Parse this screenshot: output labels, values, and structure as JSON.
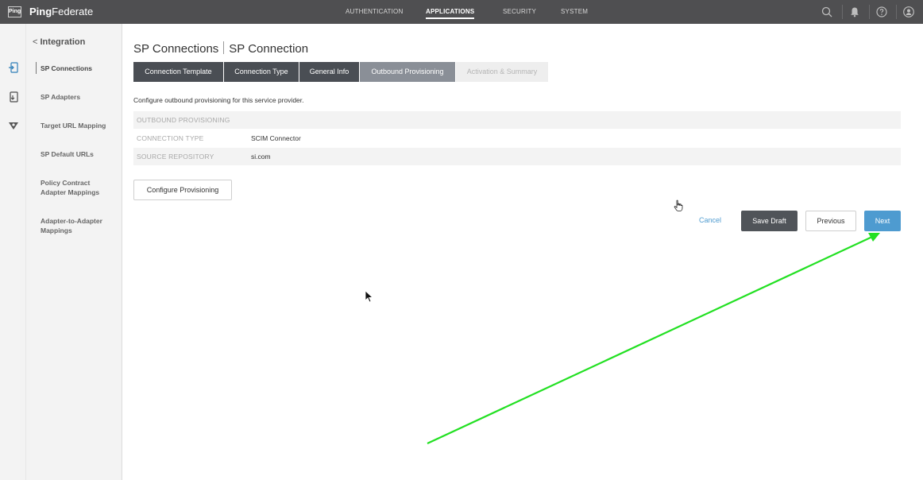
{
  "app": {
    "logo_text": "Ping",
    "brand_bold": "Ping",
    "brand_rest": "Federate"
  },
  "topnav": [
    {
      "label": "AUTHENTICATION",
      "active": false
    },
    {
      "label": "APPLICATIONS",
      "active": true
    },
    {
      "label": "SECURITY",
      "active": false
    },
    {
      "label": "SYSTEM",
      "active": false
    }
  ],
  "top_icons": [
    "search-icon",
    "bell-icon",
    "help-icon",
    "user-icon"
  ],
  "strip_icons": [
    "connection-icon",
    "adapter-icon",
    "mapping-icon"
  ],
  "sidebar": {
    "back_label": "Integration",
    "back_chevron": "<",
    "items": [
      {
        "label": "SP Connections",
        "active": true
      },
      {
        "label": "SP Adapters",
        "active": false
      },
      {
        "label": "Target URL Mapping",
        "active": false
      },
      {
        "label": "SP Default URLs",
        "active": false
      },
      {
        "label": "Policy Contract Adapter Mappings",
        "active": false
      },
      {
        "label": "Adapter-to-Adapter Mappings",
        "active": false
      }
    ]
  },
  "page": {
    "title_main": "SP Connections",
    "title_sub": "SP Connection",
    "instruction": "Configure outbound provisioning for this service provider."
  },
  "tabs": [
    {
      "label": "Connection Template",
      "state": "done"
    },
    {
      "label": "Connection Type",
      "state": "done"
    },
    {
      "label": "General Info",
      "state": "done"
    },
    {
      "label": "Outbound Provisioning",
      "state": "current"
    },
    {
      "label": "Activation & Summary",
      "state": "future"
    }
  ],
  "grid": {
    "header": "OUTBOUND PROVISIONING",
    "rows": [
      {
        "key": "CONNECTION TYPE",
        "value": "SCIM Connector"
      },
      {
        "key": "SOURCE REPOSITORY",
        "value": "si.com"
      }
    ]
  },
  "buttons": {
    "configure": "Configure Provisioning",
    "cancel": "Cancel",
    "save_draft": "Save Draft",
    "previous": "Previous",
    "next": "Next"
  },
  "colors": {
    "topbar": "#4f4f51",
    "primary": "#4e9bd0",
    "tab_done": "#4a4e54",
    "tab_current": "#8a8f97",
    "annotation": "#22e022"
  }
}
